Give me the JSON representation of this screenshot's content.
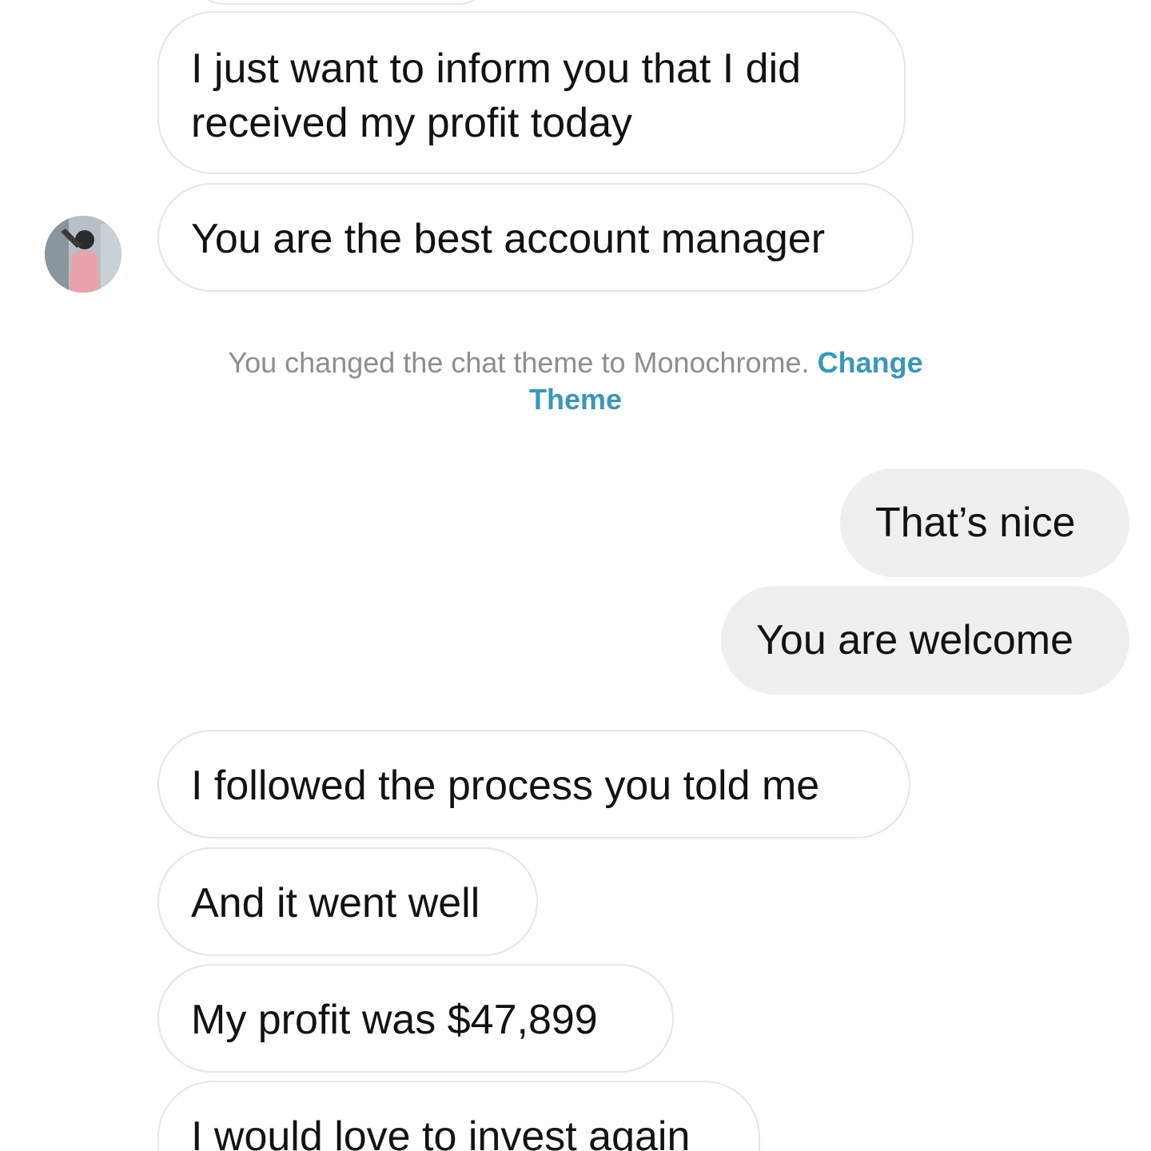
{
  "messages": {
    "incoming_1": "I just want to inform you that I did\nreceived my profit today",
    "incoming_1_line1": "I just want to inform you that I did",
    "incoming_1_line2": "received my profit today",
    "incoming_2": "You are the best account manager",
    "outgoing_1": "That’s nice",
    "outgoing_2": "You are welcome",
    "incoming_3": "I followed the process you told me",
    "incoming_4": "And it went well",
    "incoming_5": "My profit was $47,899",
    "incoming_6": "I would love to invest again"
  },
  "system_notice": {
    "text": "You changed the chat theme to Monochrome.",
    "link_line1": "Change",
    "link_line2": "Theme"
  },
  "avatar": {
    "icon": "profile-photo"
  },
  "colors": {
    "link": "#3a97b8",
    "outgoing_bubble": "#efefef",
    "incoming_border": "#e6e6e6",
    "system_text": "#8e8e8e"
  }
}
